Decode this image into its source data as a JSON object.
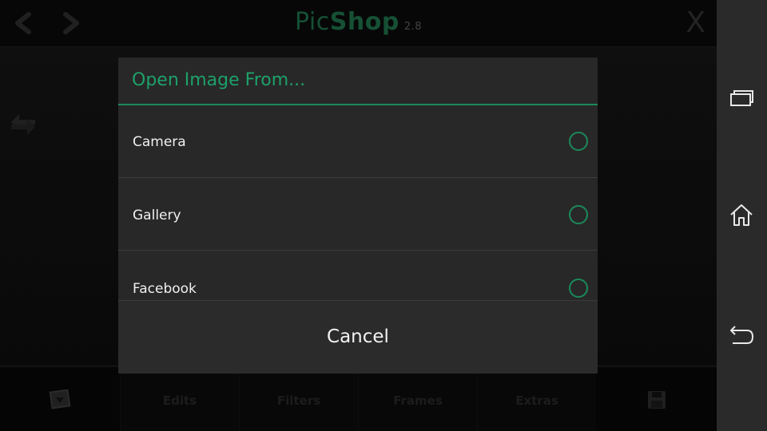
{
  "app": {
    "title_pic": "Pic",
    "title_shop": "Shop",
    "version": "2.8",
    "close_label": "X"
  },
  "toolbar": {
    "tabs": [
      "Edits",
      "Filters",
      "Frames",
      "Extras"
    ]
  },
  "dialog": {
    "title": "Open Image From...",
    "options": [
      "Camera",
      "Gallery",
      "Facebook"
    ],
    "cancel_label": "Cancel"
  },
  "colors": {
    "accent": "#1b8a5b",
    "dialog_bg": "#282828"
  },
  "icons": {
    "back": "chevron-left-icon",
    "forward": "chevron-right-icon",
    "swap": "swap-arrows-icon",
    "open": "open-image-icon",
    "save": "floppy-disk-icon",
    "recent": "recent-apps-icon",
    "home": "home-icon",
    "system_back": "back-arrow-icon"
  }
}
